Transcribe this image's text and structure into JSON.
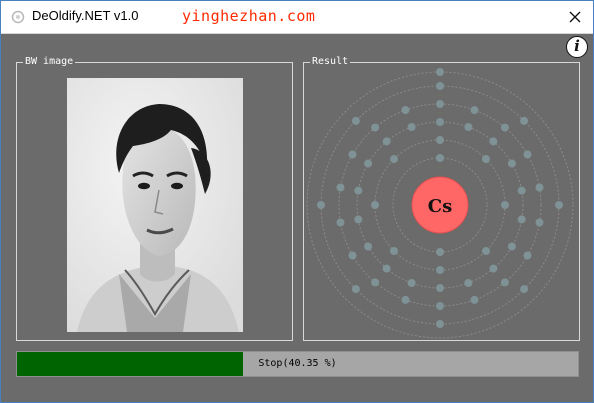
{
  "window": {
    "title": "DeOldify.NET v1.0",
    "watermark": "yinghezhan.com"
  },
  "icons": {
    "app": "app-icon",
    "close": "close-icon",
    "info": "info-icon",
    "info_glyph": "i"
  },
  "bw_panel": {
    "label": "BW image"
  },
  "result_panel": {
    "label": "Result",
    "element_symbol": "Cs",
    "shell_electrons": [
      2,
      8,
      18,
      18,
      8,
      1
    ]
  },
  "progress": {
    "text": "Stop(40.35 %)",
    "percent": 40.35
  },
  "colors": {
    "progress_fill": "#006400",
    "nucleus": "#ff6666",
    "watermark": "#ff2a00"
  }
}
